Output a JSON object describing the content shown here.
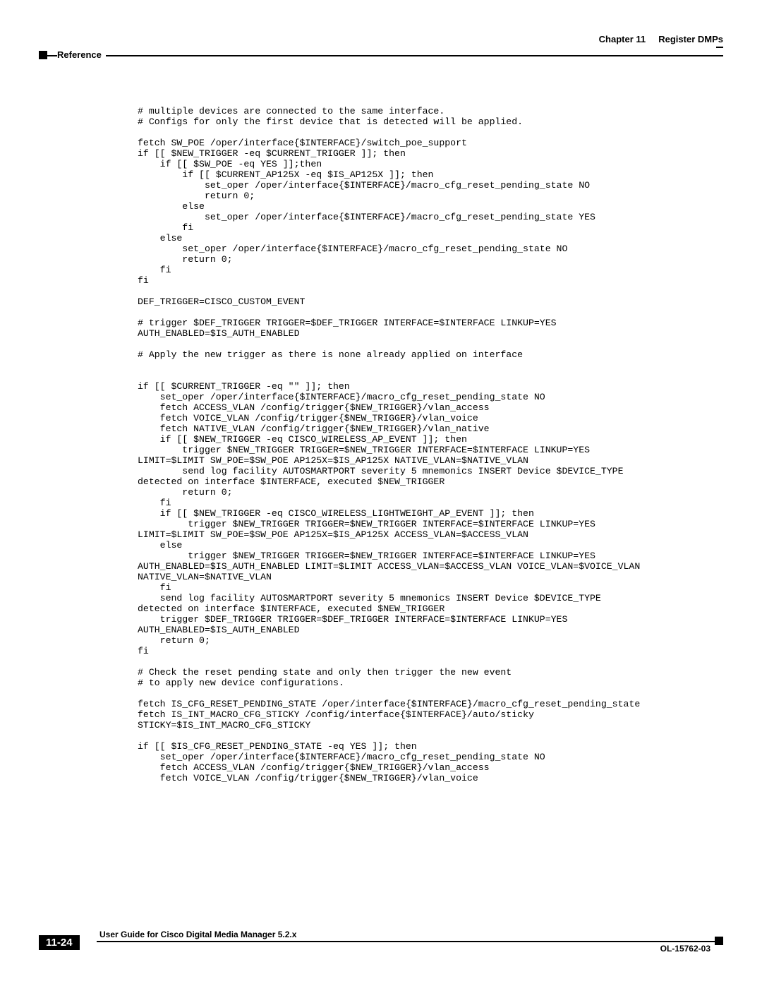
{
  "header": {
    "chapter_label": "Chapter 11",
    "chapter_title": "Register DMPs",
    "section": "Reference"
  },
  "code": "# multiple devices are connected to the same interface.\n# Configs for only the first device that is detected will be applied.\n\nfetch SW_POE /oper/interface{$INTERFACE}/switch_poe_support\nif [[ $NEW_TRIGGER -eq $CURRENT_TRIGGER ]]; then\n    if [[ $SW_POE -eq YES ]];then\n        if [[ $CURRENT_AP125X -eq $IS_AP125X ]]; then\n            set_oper /oper/interface{$INTERFACE}/macro_cfg_reset_pending_state NO\n            return 0;\n        else\n            set_oper /oper/interface{$INTERFACE}/macro_cfg_reset_pending_state YES\n        fi\n    else\n        set_oper /oper/interface{$INTERFACE}/macro_cfg_reset_pending_state NO\n        return 0;\n    fi\nfi\n\nDEF_TRIGGER=CISCO_CUSTOM_EVENT\n\n# trigger $DEF_TRIGGER TRIGGER=$DEF_TRIGGER INTERFACE=$INTERFACE LINKUP=YES \nAUTH_ENABLED=$IS_AUTH_ENABLED\n\n# Apply the new trigger as there is none already applied on interface\n\n\nif [[ $CURRENT_TRIGGER -eq \"\" ]]; then\n    set_oper /oper/interface{$INTERFACE}/macro_cfg_reset_pending_state NO\n    fetch ACCESS_VLAN /config/trigger{$NEW_TRIGGER}/vlan_access\n    fetch VOICE_VLAN /config/trigger{$NEW_TRIGGER}/vlan_voice\n    fetch NATIVE_VLAN /config/trigger{$NEW_TRIGGER}/vlan_native\n    if [[ $NEW_TRIGGER -eq CISCO_WIRELESS_AP_EVENT ]]; then\n        trigger $NEW_TRIGGER TRIGGER=$NEW_TRIGGER INTERFACE=$INTERFACE LINKUP=YES \nLIMIT=$LIMIT SW_POE=$SW_POE AP125X=$IS_AP125X NATIVE_VLAN=$NATIVE_VLAN\n        send log facility AUTOSMARTPORT severity 5 mnemonics INSERT Device $DEVICE_TYPE \ndetected on interface $INTERFACE, executed $NEW_TRIGGER\n        return 0;\n    fi\n    if [[ $NEW_TRIGGER -eq CISCO_WIRELESS_LIGHTWEIGHT_AP_EVENT ]]; then\n         trigger $NEW_TRIGGER TRIGGER=$NEW_TRIGGER INTERFACE=$INTERFACE LINKUP=YES \nLIMIT=$LIMIT SW_POE=$SW_POE AP125X=$IS_AP125X ACCESS_VLAN=$ACCESS_VLAN\n    else\n         trigger $NEW_TRIGGER TRIGGER=$NEW_TRIGGER INTERFACE=$INTERFACE LINKUP=YES \nAUTH_ENABLED=$IS_AUTH_ENABLED LIMIT=$LIMIT ACCESS_VLAN=$ACCESS_VLAN VOICE_VLAN=$VOICE_VLAN \nNATIVE_VLAN=$NATIVE_VLAN\n    fi\n    send log facility AUTOSMARTPORT severity 5 mnemonics INSERT Device $DEVICE_TYPE \ndetected on interface $INTERFACE, executed $NEW_TRIGGER\n    trigger $DEF_TRIGGER TRIGGER=$DEF_TRIGGER INTERFACE=$INTERFACE LINKUP=YES \nAUTH_ENABLED=$IS_AUTH_ENABLED\n    return 0;\nfi\n\n# Check the reset pending state and only then trigger the new event \n# to apply new device configurations.\n\nfetch IS_CFG_RESET_PENDING_STATE /oper/interface{$INTERFACE}/macro_cfg_reset_pending_state\nfetch IS_INT_MACRO_CFG_STICKY /config/interface{$INTERFACE}/auto/sticky\nSTICKY=$IS_INT_MACRO_CFG_STICKY\n\nif [[ $IS_CFG_RESET_PENDING_STATE -eq YES ]]; then\n    set_oper /oper/interface{$INTERFACE}/macro_cfg_reset_pending_state NO\n    fetch ACCESS_VLAN /config/trigger{$NEW_TRIGGER}/vlan_access\n    fetch VOICE_VLAN /config/trigger{$NEW_TRIGGER}/vlan_voice",
  "footer": {
    "guide_title": "User Guide for Cisco Digital Media Manager 5.2.x",
    "page_number": "11-24",
    "doc_id": "OL-15762-03"
  }
}
